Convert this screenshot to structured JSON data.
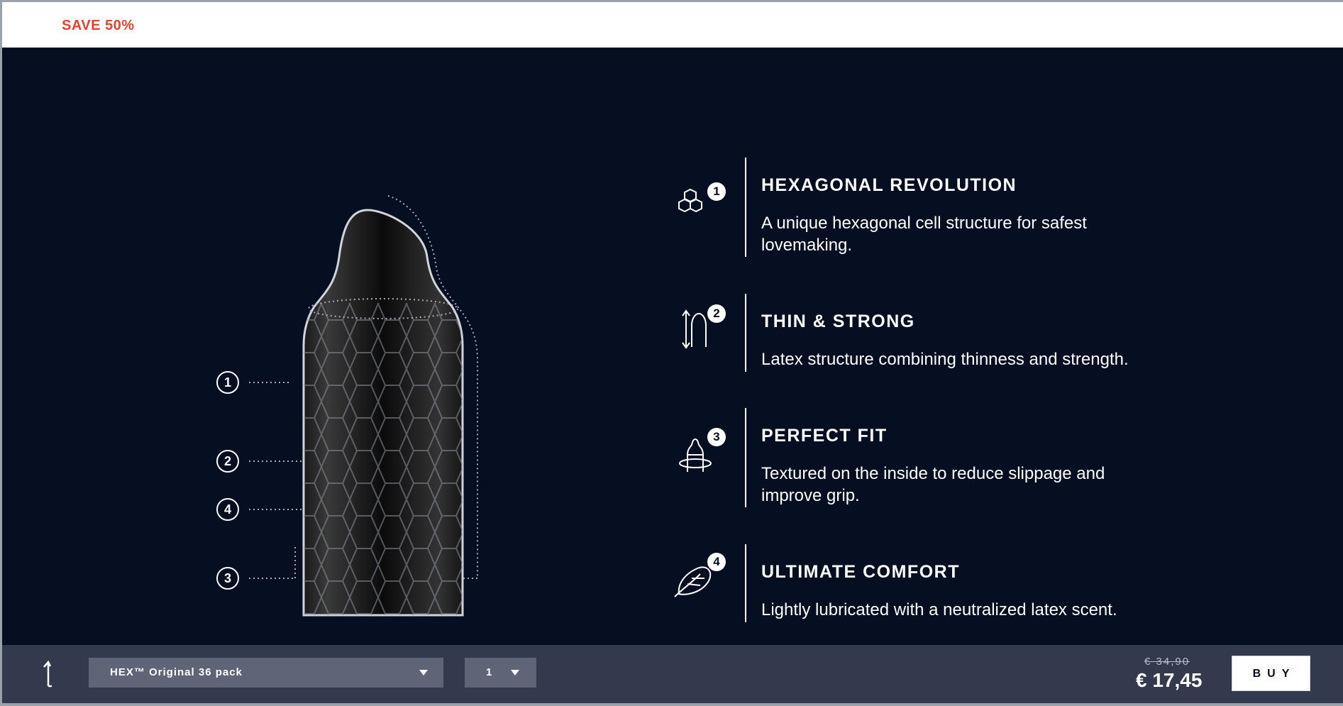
{
  "promo": {
    "badge": "SAVE 50%"
  },
  "product_figure": {
    "callouts": [
      "1",
      "2",
      "4",
      "3"
    ]
  },
  "features": [
    {
      "number": "1",
      "icon": "hexagon-cluster-icon",
      "title": "HEXAGONAL REVOLUTION",
      "description": "A unique hexagonal cell structure for safest lovemaking."
    },
    {
      "number": "2",
      "icon": "thin-strong-arrows-icon",
      "title": "THIN & STRONG",
      "description": "Latex structure combining thinness and strength."
    },
    {
      "number": "3",
      "icon": "fit-bottle-icon",
      "title": "PERFECT FIT",
      "description": "Textured on the inside to reduce slippage and improve grip."
    },
    {
      "number": "4",
      "icon": "feather-icon",
      "title": "ULTIMATE COMFORT",
      "description": "Lightly lubricated with a neutralized latex scent."
    }
  ],
  "purchase_bar": {
    "back_to_top_icon": "arrow-up-icon",
    "variant": "HEX™ Original 36 pack",
    "quantity": "1",
    "old_price": "€ 34,90",
    "price": "€ 17,45",
    "buy_label": "BUY"
  },
  "colors": {
    "hero_background": "#060f22",
    "bar_background": "#333a4d",
    "select_background": "#5f6576",
    "promo_accent": "#e8412c"
  }
}
